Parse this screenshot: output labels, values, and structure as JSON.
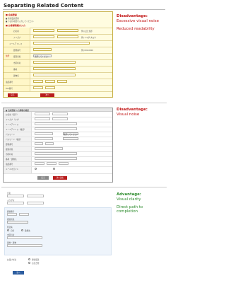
{
  "page": {
    "title": "Separating Related Content"
  },
  "annotations": [
    {
      "heading": "Disadvantage:",
      "lines": [
        "Excessive visual noise",
        "Reduced readability"
      ]
    },
    {
      "heading": "Disadvantage:",
      "lines": [
        "Visual noise"
      ]
    },
    {
      "heading": "Advantage:",
      "lines": [
        "Visual clarity",
        "Direct path to",
        "completion"
      ]
    }
  ],
  "colors": {
    "disadvantage": "#c21515",
    "advantage": "#2a8a2a",
    "form1_background": "#fffce0",
    "primary_button": "#b81d1d",
    "secondary_button": "#8a8a8a",
    "submit_button": "#2d5d9f"
  },
  "sample1": {
    "header": "■ 会員登録",
    "note_lines": [
      "■ 新規会員登録",
      "■ 下記の項目を入力してください"
    ],
    "section_header": "■ お客様情報の入力",
    "rows": [
      {
        "label": "お名前",
        "hint": "例) 山田 太郎"
      },
      {
        "label": "フリガナ",
        "hint": "例) ヤマダ タロウ"
      },
      {
        "label": "メールアドレス",
        "hint": ""
      },
      {
        "label": "郵便番号",
        "hint": "例) 000-0000"
      },
      {
        "label": "都道府県",
        "hint": "選択してください"
      },
      {
        "label": "市区町村",
        "hint": ""
      },
      {
        "label": "番地",
        "hint": ""
      },
      {
        "label": "建物名",
        "hint": ""
      },
      {
        "label": "電話番号",
        "hint": ""
      },
      {
        "label": "FAX番号",
        "hint": ""
      }
    ],
    "side_label": "住所",
    "buttons": [
      "戻る",
      "次へ"
    ]
  },
  "sample2": {
    "header": "■ 会員登録 入力情報の確認",
    "rows": [
      {
        "label": "お名前（漢字）"
      },
      {
        "label": "フリガナ（カナ）"
      },
      {
        "label": "メールアドレス"
      },
      {
        "label": "メールアドレス（確認）"
      },
      {
        "label": "パスワード"
      },
      {
        "label": "パスワード（確認）"
      },
      {
        "label": "郵便番号"
      },
      {
        "label": "都道府県"
      },
      {
        "label": "市区町村"
      },
      {
        "label": "番地・建物名"
      },
      {
        "label": "電話番号"
      },
      {
        "label": "メールマガジン"
      }
    ],
    "select_label": "選択してください",
    "buttons": [
      "戻る",
      "次へ進む"
    ]
  },
  "sample3": {
    "fields_top": [
      "氏名",
      "ふりがな"
    ],
    "fields_mid": [
      "郵便番号",
      "都道府県",
      "市区町村",
      "番地・建物"
    ],
    "radio_label": "配送先",
    "radio_options": [
      "自宅",
      "勤務先"
    ],
    "bottom_label": "お届け方法",
    "bottom_options": [
      "通常配送",
      "お急ぎ便"
    ],
    "submit": "次へ"
  }
}
